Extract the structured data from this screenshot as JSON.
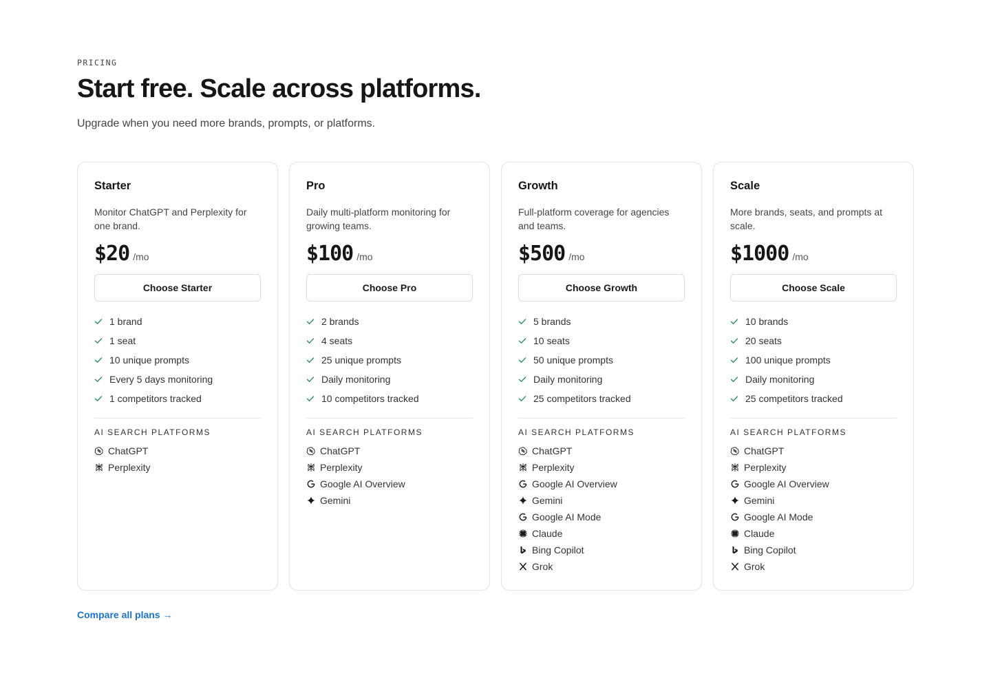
{
  "header": {
    "eyebrow": "PRICING",
    "title": "Start free. Scale across platforms.",
    "subtitle": "Upgrade when you need more brands, prompts, or platforms."
  },
  "platforms_heading": "AI SEARCH PLATFORMS",
  "plans": [
    {
      "name": "Starter",
      "description": "Monitor ChatGPT and Perplexity for one brand.",
      "price": "$20",
      "period": "/mo",
      "cta": "Choose Starter",
      "features": [
        "1 brand",
        "1 seat",
        "10 unique prompts",
        "Every 5 days monitoring",
        "1 competitors tracked"
      ],
      "platforms": [
        {
          "label": "ChatGPT",
          "icon": "chatgpt-icon"
        },
        {
          "label": "Perplexity",
          "icon": "perplexity-icon"
        }
      ]
    },
    {
      "name": "Pro",
      "description": "Daily multi-platform monitoring for growing teams.",
      "price": "$100",
      "period": "/mo",
      "cta": "Choose Pro",
      "features": [
        "2 brands",
        "4 seats",
        "25 unique prompts",
        "Daily monitoring",
        "10 competitors tracked"
      ],
      "platforms": [
        {
          "label": "ChatGPT",
          "icon": "chatgpt-icon"
        },
        {
          "label": "Perplexity",
          "icon": "perplexity-icon"
        },
        {
          "label": "Google AI Overview",
          "icon": "google-icon"
        },
        {
          "label": "Gemini",
          "icon": "gemini-icon"
        }
      ]
    },
    {
      "name": "Growth",
      "description": "Full-platform coverage for agencies and teams.",
      "price": "$500",
      "period": "/mo",
      "cta": "Choose Growth",
      "features": [
        "5 brands",
        "10 seats",
        "50 unique prompts",
        "Daily monitoring",
        "25 competitors tracked"
      ],
      "platforms": [
        {
          "label": "ChatGPT",
          "icon": "chatgpt-icon"
        },
        {
          "label": "Perplexity",
          "icon": "perplexity-icon"
        },
        {
          "label": "Google AI Overview",
          "icon": "google-icon"
        },
        {
          "label": "Gemini",
          "icon": "gemini-icon"
        },
        {
          "label": "Google AI Mode",
          "icon": "google-icon"
        },
        {
          "label": "Claude",
          "icon": "claude-icon"
        },
        {
          "label": "Bing Copilot",
          "icon": "bing-icon"
        },
        {
          "label": "Grok",
          "icon": "grok-icon"
        }
      ]
    },
    {
      "name": "Scale",
      "description": "More brands, seats, and prompts at scale.",
      "price": "$1000",
      "period": "/mo",
      "cta": "Choose Scale",
      "features": [
        "10 brands",
        "20 seats",
        "100 unique prompts",
        "Daily monitoring",
        "25 competitors tracked"
      ],
      "platforms": [
        {
          "label": "ChatGPT",
          "icon": "chatgpt-icon"
        },
        {
          "label": "Perplexity",
          "icon": "perplexity-icon"
        },
        {
          "label": "Google AI Overview",
          "icon": "google-icon"
        },
        {
          "label": "Gemini",
          "icon": "gemini-icon"
        },
        {
          "label": "Google AI Mode",
          "icon": "google-icon"
        },
        {
          "label": "Claude",
          "icon": "claude-icon"
        },
        {
          "label": "Bing Copilot",
          "icon": "bing-icon"
        },
        {
          "label": "Grok",
          "icon": "grok-icon"
        }
      ]
    }
  ],
  "compare_link": "Compare all plans →",
  "colors": {
    "check": "#2e8a6e",
    "link": "#1a73c8",
    "border": "#e4e4e4"
  }
}
